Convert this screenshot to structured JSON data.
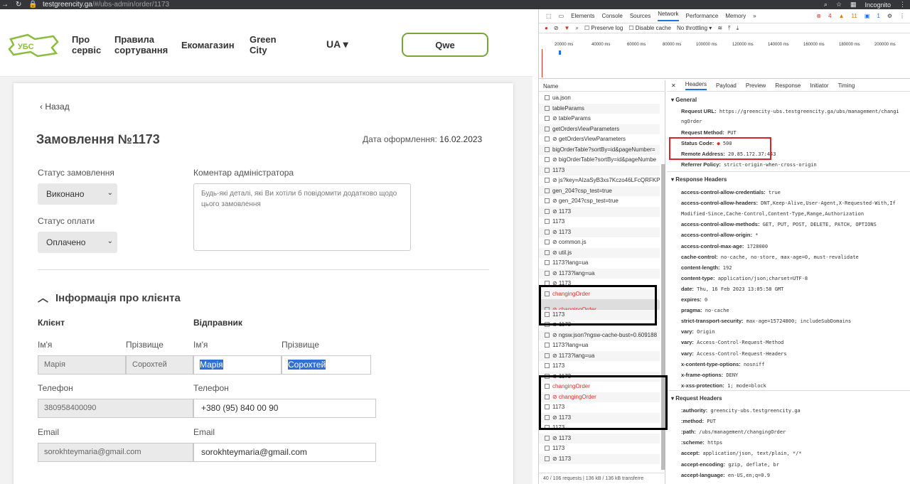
{
  "browser": {
    "url_host": "testgreencity.ga",
    "url_path": "/#/ubs-admin/order/1173",
    "incognito_label": "Incognito"
  },
  "site": {
    "logo_text": "УБС",
    "nav": [
      "Про сервіс",
      "Правила сортування",
      "Екомагазин",
      "Green City"
    ],
    "lang": "UA",
    "user_button": "Qwe"
  },
  "order": {
    "back": "Назад",
    "title": "Замовлення №1173",
    "date_label": "Дата оформлення:",
    "date_value": "16.02.2023",
    "status_label": "Статус замовлення",
    "status_value": "Виконано",
    "payment_label": "Статус оплати",
    "payment_value": "Оплачено",
    "comment_label": "Коментар адміністратора",
    "comment_placeholder": "Будь-які деталі, які Ви хотіли б повідомити додатково щодо цього замовлення",
    "client_section": "Інформація про клієнта",
    "client_label": "Клієнт",
    "sender_label": "Відправник",
    "name_label": "Ім'я",
    "surname_label": "Прізвище",
    "client_name": "Марія",
    "client_surname": "Сорохтей",
    "sender_name": "Марія",
    "sender_surname": "Сорохтей",
    "phone_label": "Телефон",
    "client_phone": "380958400090",
    "sender_phone": "+380 (95) 840 00 90",
    "email_label": "Email",
    "client_email": "sorokhteymaria@gmail.com",
    "sender_email": "sorokhteymaria@gmail.com"
  },
  "devtools": {
    "tabs": [
      "Elements",
      "Console",
      "Sources",
      "Network",
      "Performance",
      "Memory"
    ],
    "active_tab": "Network",
    "errors": "4",
    "warnings": "11",
    "messages": "1",
    "toolbar": {
      "preserve_log": "Preserve log",
      "disable_cache": "Disable cache",
      "throttling": "No throttling"
    },
    "timeline_ticks": [
      "20000 ms",
      "40000 ms",
      "60000 ms",
      "80000 ms",
      "100000 ms",
      "120000 ms",
      "140000 ms",
      "160000 ms",
      "180000 ms",
      "200000 ms"
    ],
    "name_header": "Name",
    "requests": [
      "ua.json",
      "tableParams",
      "⊘ tableParams",
      "getOrdersViewParameters",
      "⊘ getOrdersViewParameters",
      "bigOrderTable?sortBy=id&pageNumber=",
      "⊘ bigOrderTable?sortBy=id&pageNumbe",
      "1173",
      "⊘ js?key=AIzaSyB3xs7Kczo46LFcQRFKPM",
      "gen_204?csp_test=true",
      "⊘ gen_204?csp_test=true",
      "⊘ 1173",
      "1173",
      "⊘ 1173",
      "⊘ common.js",
      "⊘ util.js",
      "1173?lang=ua",
      "⊘ 1173?lang=ua",
      "⊘ 1173",
      "changingOrder",
      "⊘ changingOrder",
      "1173",
      "⊘ 1173",
      "⊘ ngsw.json?ngsw-cache-bust=0.609188",
      "1173?lang=ua",
      "⊘ 1173?lang=ua",
      "1173",
      "⊘ 1173",
      "changingOrder",
      "⊘ changingOrder",
      "1173",
      "⊘ 1173",
      "1173",
      "⊘ 1173",
      "1173",
      "⊘ 1173"
    ],
    "footer": "40 / 106 requests  |  136 kB / 136 kB transferre",
    "subtabs": [
      "Headers",
      "Payload",
      "Preview",
      "Response",
      "Initiator",
      "Timing"
    ],
    "general_title": "General",
    "general": {
      "request_url_key": "Request URL:",
      "request_url_val": "https://greencity-ubs.testgreencity.ga/ubs/management/changi",
      "request_url_cont": "ngOrder",
      "method_key": "Request Method:",
      "method_val": "PUT",
      "status_key": "Status Code:",
      "status_val": "500",
      "remote_key": "Remote Address:",
      "remote_val": "20.85.172.37:443",
      "referrer_key": "Referrer Policy:",
      "referrer_val": "strict-origin-when-cross-origin"
    },
    "response_headers_title": "Response Headers",
    "response_headers": [
      [
        "access-control-allow-credentials:",
        "true"
      ],
      [
        "access-control-allow-headers:",
        "DNT,Keep-Alive,User-Agent,X-Requested-With,If"
      ],
      [
        "",
        "Modified-Since,Cache-Control,Content-Type,Range,Authorization"
      ],
      [
        "access-control-allow-methods:",
        "GET, PUT, POST, DELETE, PATCH, OPTIONS"
      ],
      [
        "access-control-allow-origin:",
        "*"
      ],
      [
        "access-control-max-age:",
        "1728000"
      ],
      [
        "cache-control:",
        "no-cache, no-store, max-age=0, must-revalidate"
      ],
      [
        "content-length:",
        "192"
      ],
      [
        "content-type:",
        "application/json;charset=UTF-8"
      ],
      [
        "date:",
        "Thu, 16 Feb 2023 13:05:58 GMT"
      ],
      [
        "expires:",
        "0"
      ],
      [
        "pragma:",
        "no-cache"
      ],
      [
        "strict-transport-security:",
        "max-age=15724800; includeSubDomains"
      ],
      [
        "vary:",
        "Origin"
      ],
      [
        "vary:",
        "Access-Control-Request-Method"
      ],
      [
        "vary:",
        "Access-Control-Request-Headers"
      ],
      [
        "x-content-type-options:",
        "nosniff"
      ],
      [
        "x-frame-options:",
        "DENY"
      ],
      [
        "x-xss-protection:",
        "1; mode=block"
      ]
    ],
    "request_headers_title": "Request Headers",
    "request_headers": [
      [
        ":authority:",
        "greencity-ubs.testgreencity.ga"
      ],
      [
        ":method:",
        "PUT"
      ],
      [
        ":path:",
        "/ubs/management/changingOrder"
      ],
      [
        ":scheme:",
        "https"
      ],
      [
        "accept:",
        "application/json, text/plain, */*"
      ],
      [
        "accept-encoding:",
        "gzip, deflate, br"
      ],
      [
        "accept-language:",
        "en-US,en;q=0.9"
      ]
    ]
  }
}
